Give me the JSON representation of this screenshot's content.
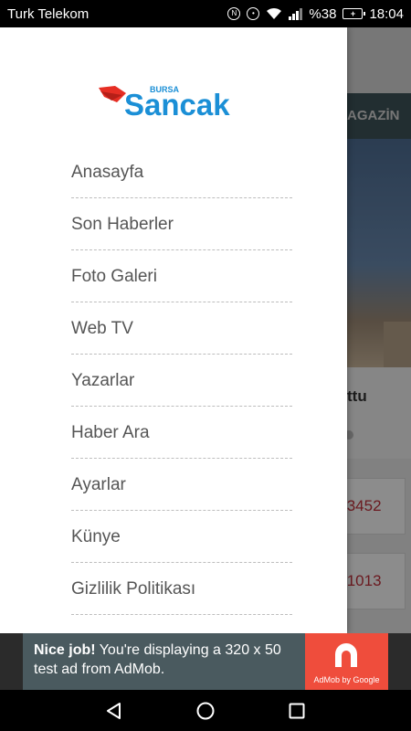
{
  "status_bar": {
    "carrier": "Turk Telekom",
    "battery_text": "%38",
    "time": "18:04"
  },
  "background": {
    "tab_label": "AGAZİN",
    "headline_fragment": "ttu",
    "card1_value": ".3452",
    "card2_value": ".1013"
  },
  "drawer": {
    "logo_small": "BURSA",
    "logo_main": "Sancak",
    "menu": [
      {
        "label": "Anasayfa"
      },
      {
        "label": "Son Haberler"
      },
      {
        "label": "Foto Galeri"
      },
      {
        "label": "Web TV"
      },
      {
        "label": "Yazarlar"
      },
      {
        "label": "Haber Ara"
      },
      {
        "label": "Ayarlar"
      },
      {
        "label": "Künye"
      },
      {
        "label": "Gizlilik Politikası"
      }
    ]
  },
  "ad": {
    "bold": "Nice job!",
    "text": "You're displaying a 320 x 50 test ad from AdMob.",
    "logo_caption": "AdMob by Google"
  },
  "colors": {
    "logo_blue": "#1b8fd6",
    "logo_red": "#e62e24",
    "ad_red": "#ef4d3c",
    "tab_bar": "#3f5459"
  },
  "icons": {
    "nav_back": "triangle-back-icon",
    "nav_home": "circle-home-icon",
    "nav_recents": "square-recents-icon"
  }
}
